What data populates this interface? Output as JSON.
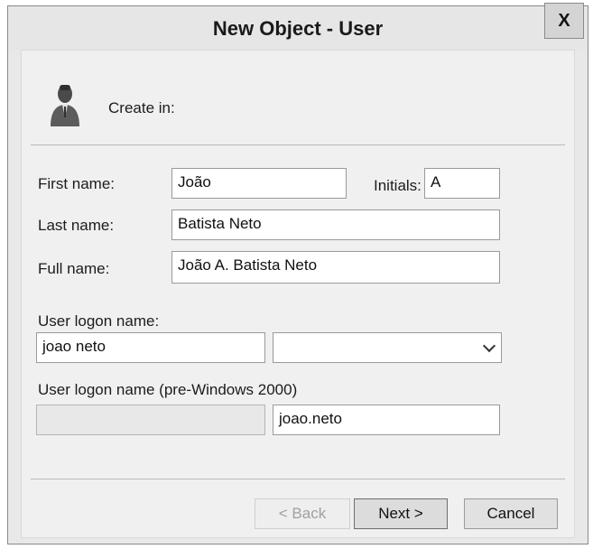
{
  "window": {
    "title": "New Object - User",
    "close_label": "X"
  },
  "header": {
    "user_icon": "user-silhouette-icon",
    "create_in_label": "Create in:"
  },
  "form": {
    "first_name_label": "First name:",
    "first_name_value": "João",
    "initials_label": "Initials:",
    "initials_value": "A",
    "last_name_label": "Last name:",
    "last_name_value": "Batista Neto",
    "full_name_label": "Full name:",
    "full_name_value": "João A. Batista Neto",
    "logon_name_label": "User logon name:",
    "logon_name_value": "joao neto",
    "upn_suffix_value": "",
    "pre2000_label": "User logon name (pre-Windows 2000)",
    "pre2000_domain_value": "",
    "pre2000_name_value": "joao.neto"
  },
  "buttons": {
    "back_label": "< Back",
    "next_label": "Next >",
    "cancel_label": "Cancel"
  }
}
